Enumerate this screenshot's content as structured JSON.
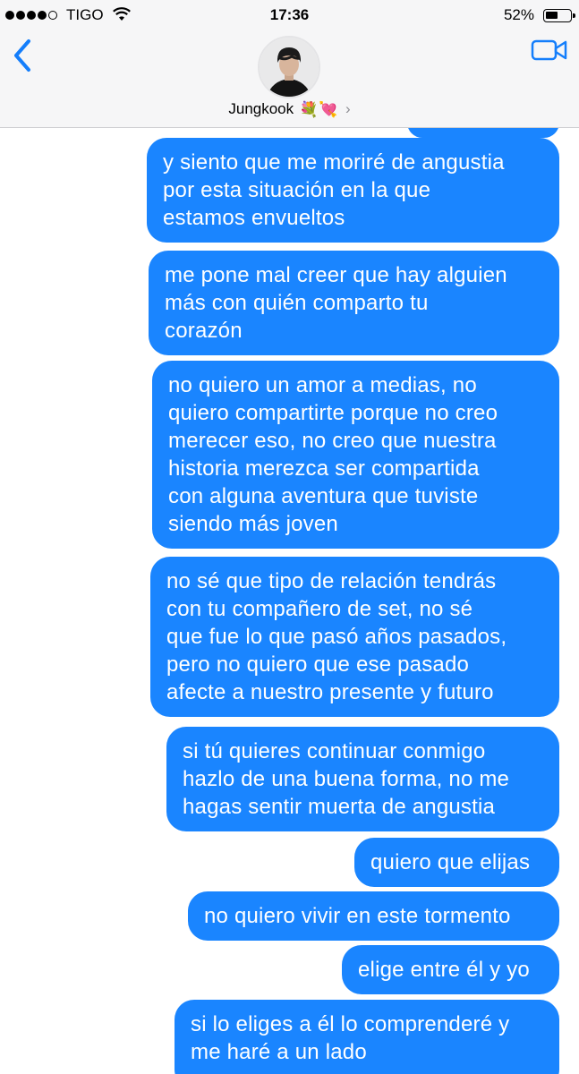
{
  "status_bar": {
    "carrier": "TIGO",
    "time": "17:36",
    "battery_percent": "52%",
    "battery_level": 0.52,
    "signal_bars": 4
  },
  "header": {
    "contact_name": "Jungkook",
    "contact_emoji": "💐💘",
    "chevron": "›"
  },
  "colors": {
    "bubble_blue": "#1a85ff",
    "ios_blue": "#147efb",
    "header_bg": "#f6f6f7"
  },
  "messages": [
    "",
    "y siento que me moriré de angustia\npor esta situación en la que\nestamos envueltos",
    "me pone mal creer que hay alguien\nmás con quién comparto tu\ncorazón",
    "no quiero un amor a medias, no\nquiero compartirte porque no creo\nmerecer eso, no creo que nuestra\nhistoria merezca ser compartida\ncon alguna aventura que tuviste\nsiendo más joven",
    "no sé que tipo de relación tendrás\ncon tu compañero de set, no sé\nque fue lo que pasó años pasados,\npero no quiero que ese pasado\nafecte a nuestro presente y futuro",
    "si tú quieres continuar conmigo\nhazlo de una buena forma, no me\nhagas sentir muerta de angustia",
    "quiero que elijas",
    "no quiero vivir en este tormento",
    "elige entre él y yo",
    "si lo eliges a él lo comprenderé y\nme haré a un lado"
  ]
}
